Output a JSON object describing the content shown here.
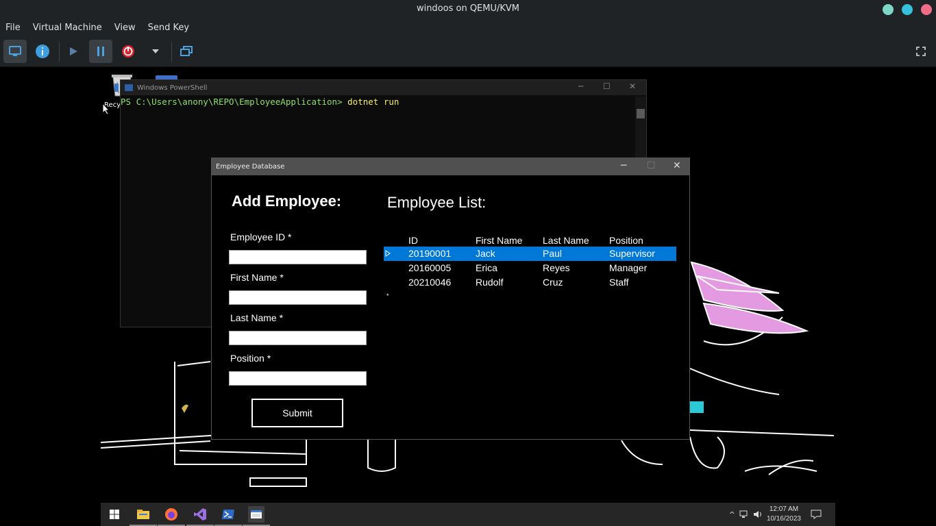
{
  "host": {
    "title": "windoos on QEMU/KVM",
    "menu": [
      "File",
      "Virtual Machine",
      "View",
      "Send Key"
    ],
    "toolbar_icons": [
      "display-icon",
      "info-icon",
      "play-icon",
      "pause-icon",
      "power-icon",
      "dropdown-icon",
      "snapshot-icon",
      "fullscreen-icon"
    ]
  },
  "desktop": {
    "recycle_label": "Recy"
  },
  "powershell": {
    "title": "Windows PowerShell",
    "prompt": "PS C:\\Users\\anony\\REPO\\EmployeeApplication>",
    "command": "dotnet run"
  },
  "app": {
    "title": "Employee Database",
    "form_title": "Add Employee:",
    "fields": [
      {
        "label": "Employee ID *",
        "value": ""
      },
      {
        "label": "First Name *",
        "value": ""
      },
      {
        "label": "Last Name *",
        "value": ""
      },
      {
        "label": "Position *",
        "value": ""
      }
    ],
    "submit_label": "Submit",
    "list_title": "Employee List:",
    "columns": [
      "ID",
      "First Name",
      "Last Name",
      "Position"
    ],
    "rows": [
      [
        "20190001",
        "Jack",
        "Paul",
        "Supervisor"
      ],
      [
        "20160005",
        "Erica",
        "Reyes",
        "Manager"
      ],
      [
        "20210046",
        "Rudolf",
        "Cruz",
        "Staff"
      ]
    ],
    "new_row_marker": "*"
  },
  "taskbar": {
    "clock_time": "12:07 AM",
    "clock_date": "10/16/2023"
  },
  "colors": {
    "selection": "#0078d7",
    "ps_prompt": "#8fe06b",
    "ps_command": "#f6f06b"
  }
}
